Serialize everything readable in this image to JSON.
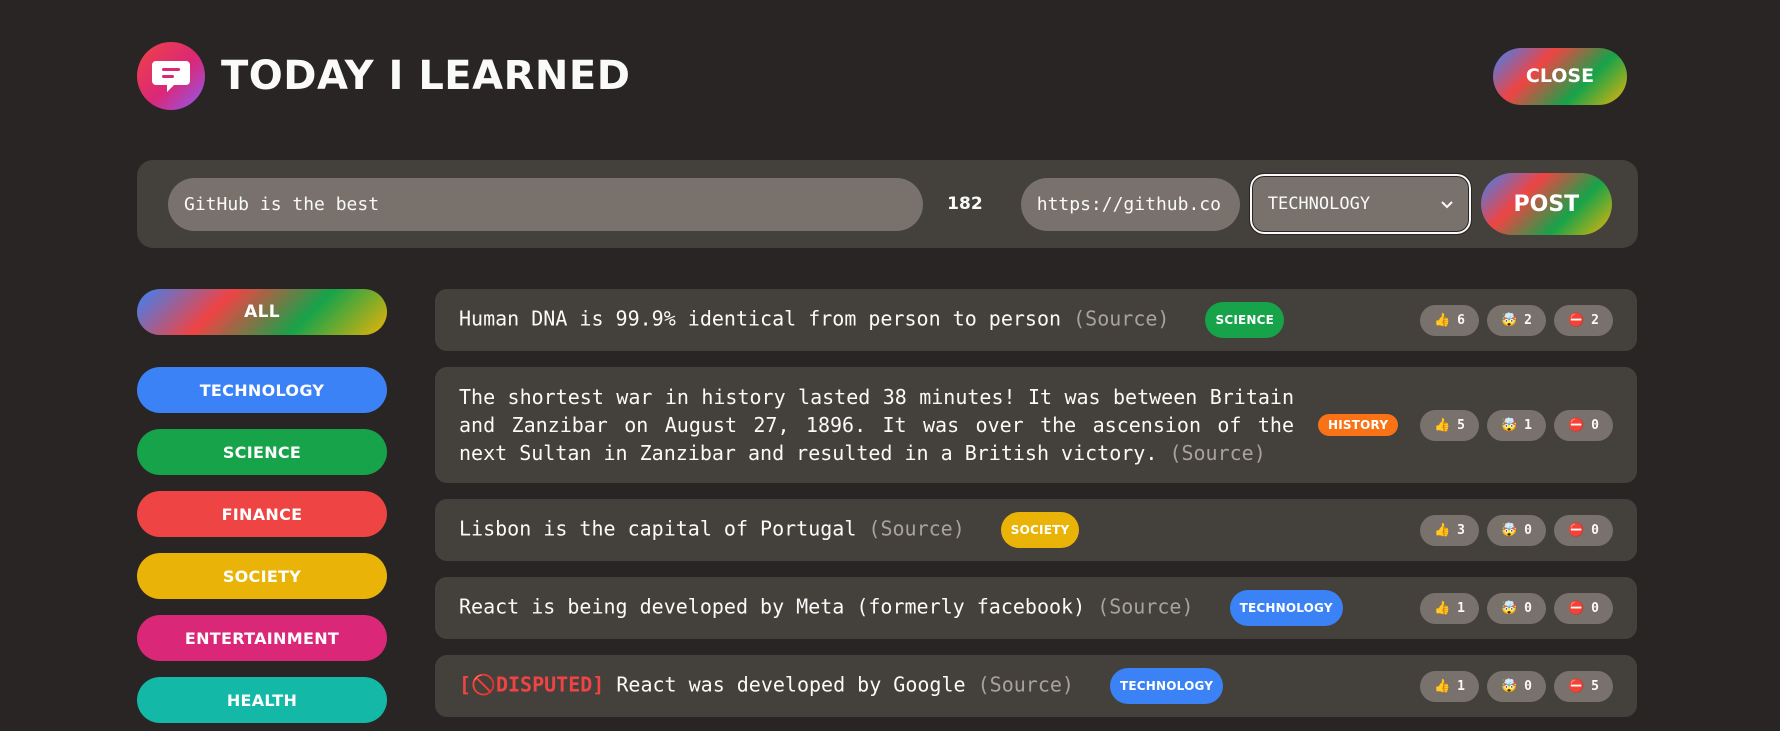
{
  "header": {
    "title": "TODAY I LEARNED",
    "close_label": "CLOSE",
    "logo_icon": "speech-bubble-icon"
  },
  "form": {
    "fact_value": "GitHub is the best",
    "char_count": "182",
    "source_value": "https://github.co",
    "category_selected": "TECHNOLOGY",
    "post_label": "POST"
  },
  "sidebar": {
    "all_label": "ALL",
    "categories": [
      {
        "label": "TECHNOLOGY",
        "color": "#3b82f6"
      },
      {
        "label": "SCIENCE",
        "color": "#16a34a"
      },
      {
        "label": "FINANCE",
        "color": "#ef4444"
      },
      {
        "label": "SOCIETY",
        "color": "#eab308"
      },
      {
        "label": "ENTERTAINMENT",
        "color": "#db2777"
      },
      {
        "label": "HEALTH",
        "color": "#14b8a6"
      }
    ]
  },
  "facts": [
    {
      "text": "Human DNA is 99.9% identical from person to person",
      "source_label": "(Source)",
      "category": "SCIENCE",
      "category_color": "#16a34a",
      "votes": {
        "interesting": "6",
        "mindblowing": "2",
        "false": "2"
      }
    },
    {
      "text": "The shortest war in history lasted 38 minutes! It was between Britain and Zanzibar on August 27, 1896. It was over the ascension of the next Sultan in Zanzibar and resulted in a British victory.",
      "source_label": "(Source)",
      "category": "HISTORY",
      "category_color": "#f97316",
      "votes": {
        "interesting": "5",
        "mindblowing": "1",
        "false": "0"
      }
    },
    {
      "text": "Lisbon is the capital of Portugal",
      "source_label": "(Source)",
      "category": "SOCIETY",
      "category_color": "#eab308",
      "votes": {
        "interesting": "3",
        "mindblowing": "0",
        "false": "0"
      }
    },
    {
      "text": "React is being developed by Meta (formerly facebook)",
      "source_label": "(Source)",
      "category": "TECHNOLOGY",
      "category_color": "#3b82f6",
      "votes": {
        "interesting": "1",
        "mindblowing": "0",
        "false": "0"
      }
    },
    {
      "disputed_label": "[🚫DISPUTED]",
      "text": "React was developed by Google",
      "source_label": "(Source)",
      "category": "TECHNOLOGY",
      "category_color": "#3b82f6",
      "votes": {
        "interesting": "1",
        "mindblowing": "0",
        "false": "5"
      }
    }
  ],
  "vote_icons": {
    "interesting": "👍",
    "mindblowing": "🤯",
    "false": "⛔️"
  }
}
